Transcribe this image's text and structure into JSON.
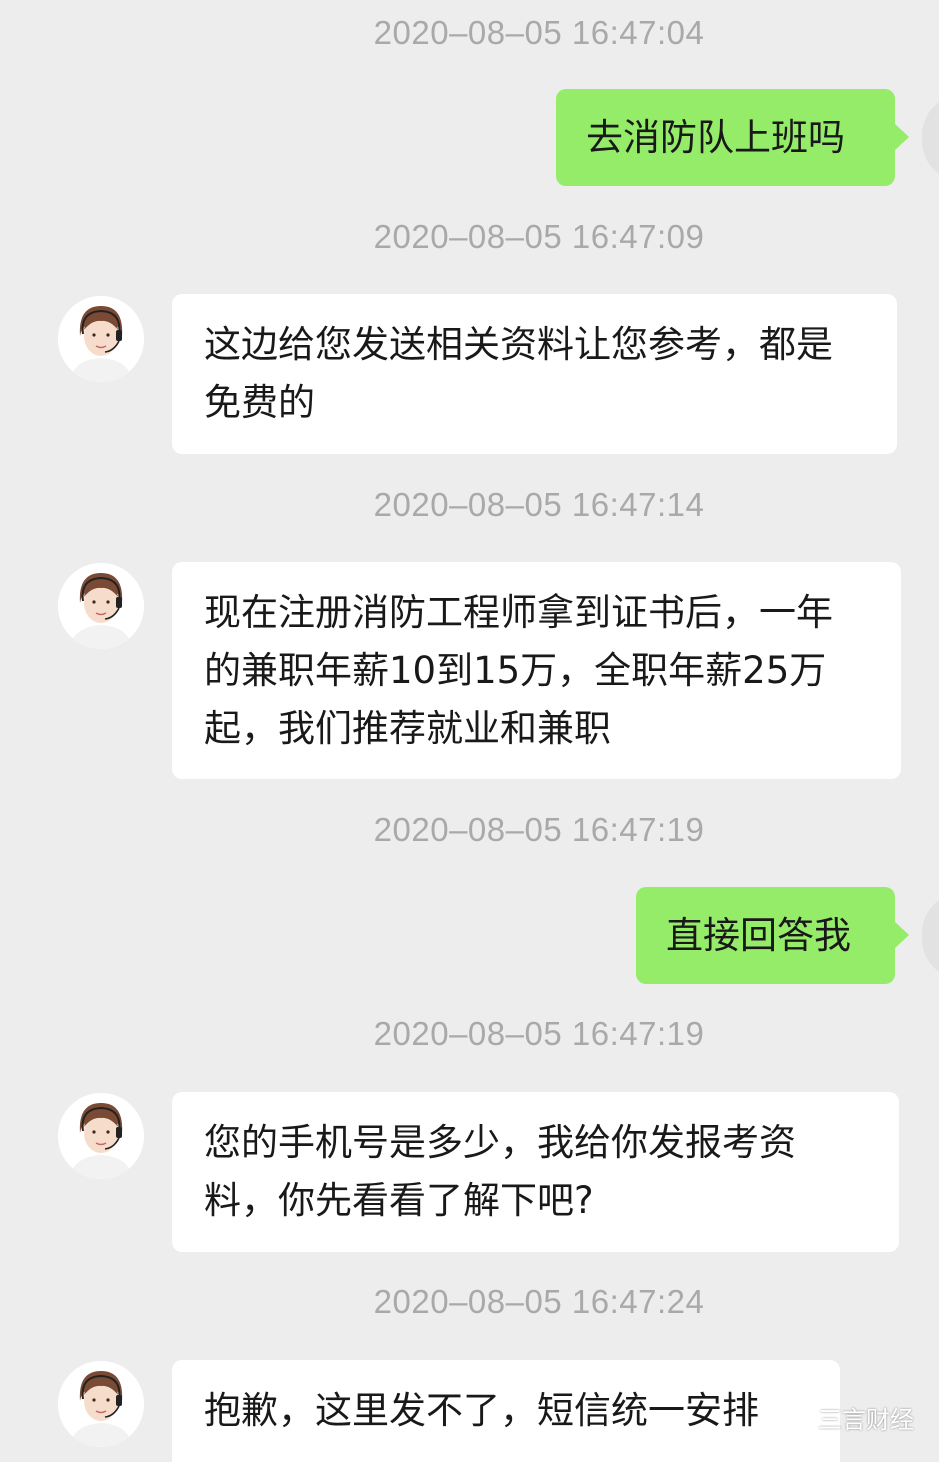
{
  "messages": [
    {
      "time": "2020–08–05 16:47:04",
      "text": "去消防队上班吗"
    },
    {
      "time": "2020–08–05 16:47:09",
      "text": "这边给您发送相关资料让您参考，都是免费的"
    },
    {
      "time": "2020–08–05 16:47:14",
      "text": "现在注册消防工程师拿到证书后，一年的兼职年薪10到15万，全职年薪25万起，我们推荐就业和兼职"
    },
    {
      "time": "2020–08–05 16:47:19",
      "text": "直接回答我"
    },
    {
      "time": "2020–08–05 16:47:19",
      "text": "您的手机号是多少，我给你发报考资料，你先看看了解下吧?"
    },
    {
      "time": "2020–08–05 16:47:24",
      "text": "抱歉，这里发不了，短信统一安排"
    }
  ],
  "watermark": {
    "text": "三言财经"
  }
}
